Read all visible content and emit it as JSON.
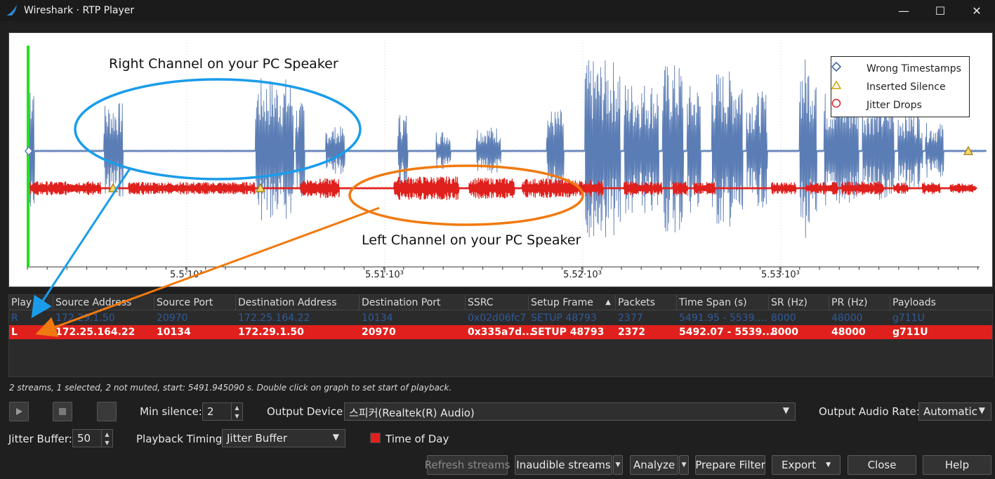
{
  "window": {
    "title": "Wireshark · RTP Player",
    "minimize": "—",
    "maximize": "☐",
    "close": "✕"
  },
  "graph": {
    "legend": [
      {
        "label": "Wrong Timestamps",
        "icon": "diamond-icon",
        "color": "#2e5a9c"
      },
      {
        "label": "Inserted Silence",
        "icon": "triangle-icon",
        "color": "#c9a400"
      },
      {
        "label": "Jitter Drops",
        "icon": "circle-icon",
        "color": "#d42020"
      }
    ],
    "x_tick_labels": [
      "5.5·10³",
      "5.51·10³",
      "5.52·10³",
      "5.53·10³"
    ],
    "annotation_right": "Right Channel on your PC Speaker",
    "annotation_left": "Left Channel on your PC Speaker",
    "colors": {
      "right_wave": "#5b7db5",
      "left_wave": "#e0201c",
      "start_marker": "#22e022",
      "right_ellipse": "#1a9cea",
      "left_ellipse": "#f07a10"
    }
  },
  "table": {
    "columns": [
      "Play",
      "Source Address",
      "Source Port",
      "Destination Address",
      "Destination Port",
      "SSRC",
      "Setup Frame",
      "Packets",
      "Time Span (s)",
      "SR (Hz)",
      "PR (Hz)",
      "Payloads"
    ],
    "rows": [
      {
        "play": "R",
        "src": "172.29.1.50",
        "sport": "20970",
        "dst": "172.25.164.22",
        "dport": "10134",
        "ssrc": "0x02d06fc7",
        "setup": "SETUP 48793",
        "packets": "2377",
        "span": "5491.95 - 5539....",
        "sr": "8000",
        "pr": "48000",
        "payload": "g711U"
      },
      {
        "play": "L",
        "src": "172.25.164.22",
        "sport": "10134",
        "dst": "172.29.1.50",
        "dport": "20970",
        "ssrc": "0x335a7d...",
        "setup": "SETUP 48793",
        "packets": "2372",
        "span": "5492.07 - 5539....",
        "sr": "8000",
        "pr": "48000",
        "payload": "g711U"
      }
    ]
  },
  "status": "2 streams, 1 selected, 2 not muted, start: 5491.945090 s. Double click on graph to set start of playback.",
  "controls": {
    "min_silence_label": "Min silence:",
    "min_silence_value": "2",
    "output_device_label": "Output Device:",
    "output_device_value": "스피커(Realtek(R) Audio)",
    "output_rate_label": "Output Audio Rate:",
    "output_rate_value": "Automatic",
    "jitter_buffer_label": "Jitter Buffer:",
    "jitter_buffer_value": "50",
    "playback_timing_label": "Playback Timing:",
    "playback_timing_value": "Jitter Buffer",
    "time_of_day_label": "Time of Day"
  },
  "buttons": {
    "refresh": "Refresh streams",
    "inaudible": "Inaudible streams",
    "analyze": "Analyze",
    "prepare_filter": "Prepare Filter",
    "export": "Export",
    "close": "Close",
    "help": "Help"
  }
}
